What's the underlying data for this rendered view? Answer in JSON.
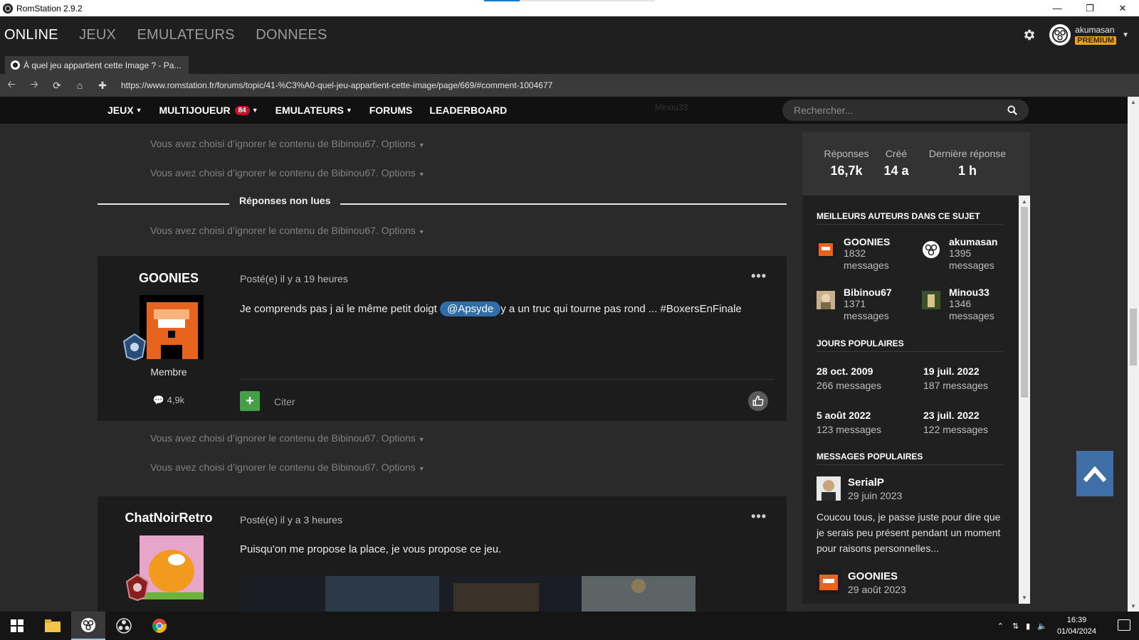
{
  "window": {
    "title": "RomStation 2.9.2"
  },
  "appbar": {
    "nav": [
      "ONLINE",
      "JEUX",
      "EMULATEURS",
      "DONNEES"
    ],
    "user": {
      "name": "akumasan",
      "badge": "PREMIUM"
    }
  },
  "browser": {
    "tab_title": "À quel jeu appartient cette Image ? - Pa...",
    "url": "https://www.romstation.fr/forums/topic/41-%C3%A0-quel-jeu-appartient-cette-image/page/669/#comment-1004677"
  },
  "sitenav": {
    "items": [
      {
        "label": "JEUX",
        "caret": true
      },
      {
        "label": "MULTIJOUEUR",
        "badge": "84",
        "caret": true
      },
      {
        "label": "EMULATEURS",
        "caret": true
      },
      {
        "label": "FORUMS"
      },
      {
        "label": "LEADERBOARD"
      }
    ],
    "ghost_user": "Minou33",
    "ghost_count": "1",
    "search_placeholder": "Rechercher..."
  },
  "ignored_text": "Vous avez choisi d’ignorer le contenu de Bibinou67.",
  "ignored_options": "Options",
  "unread_label": "Réponses non lues",
  "posts": [
    {
      "author": "GOONIES",
      "rank": "Membre",
      "count": "4,9k",
      "posted": "Posté(e) il y a 19 heures",
      "body_before": "Je comprends pas j ai le même petit doigt",
      "mention": "@Apsyde",
      "body_after": "y a un truc qui tourne pas rond ...  #BoxersEnFinale",
      "quote_label": "Citer"
    },
    {
      "author": "ChatNoirRetro",
      "posted": "Posté(e) il y a 3 heures",
      "body": "Puisqu'on me propose la place, je vous propose ce jeu."
    }
  ],
  "stats": [
    {
      "label": "Réponses",
      "value": "16,7k"
    },
    {
      "label": "Créé",
      "value": "14 a"
    },
    {
      "label": "Dernière réponse",
      "value": "1 h"
    }
  ],
  "sidebar": {
    "top_authors_title": "MEILLEURS AUTEURS DANS CE SUJET",
    "top_authors": [
      {
        "name": "GOONIES",
        "count": "1832",
        "unit": "messages"
      },
      {
        "name": "akumasan",
        "count": "1395",
        "unit": "messages"
      },
      {
        "name": "Bibinou67",
        "count": "1371",
        "unit": "messages"
      },
      {
        "name": "Minou33",
        "count": "1346",
        "unit": "messages"
      }
    ],
    "popular_days_title": "JOURS POPULAIRES",
    "popular_days": [
      {
        "date": "28 oct. 2009",
        "count": "266 messages"
      },
      {
        "date": "19 juil. 2022",
        "count": "187 messages"
      },
      {
        "date": "5 août 2022",
        "count": "123 messages"
      },
      {
        "date": "23 juil. 2022",
        "count": "122 messages"
      }
    ],
    "popular_posts_title": "MESSAGES POPULAIRES",
    "popular_posts": [
      {
        "name": "SerialP",
        "date": "29 juin 2023",
        "text": "Coucou tous, je passe juste pour dire que je serais peu présent pendant un moment pour raisons personnelles..."
      },
      {
        "name": "GOONIES",
        "date": "29 août 2023"
      }
    ]
  },
  "taskbar": {
    "time": "16:39",
    "date": "01/04/2024"
  },
  "colors": {
    "accent_blue": "#3f6fa6",
    "premium": "#e8a317",
    "badge_red": "#c8102e",
    "plus_green": "#43a047"
  }
}
